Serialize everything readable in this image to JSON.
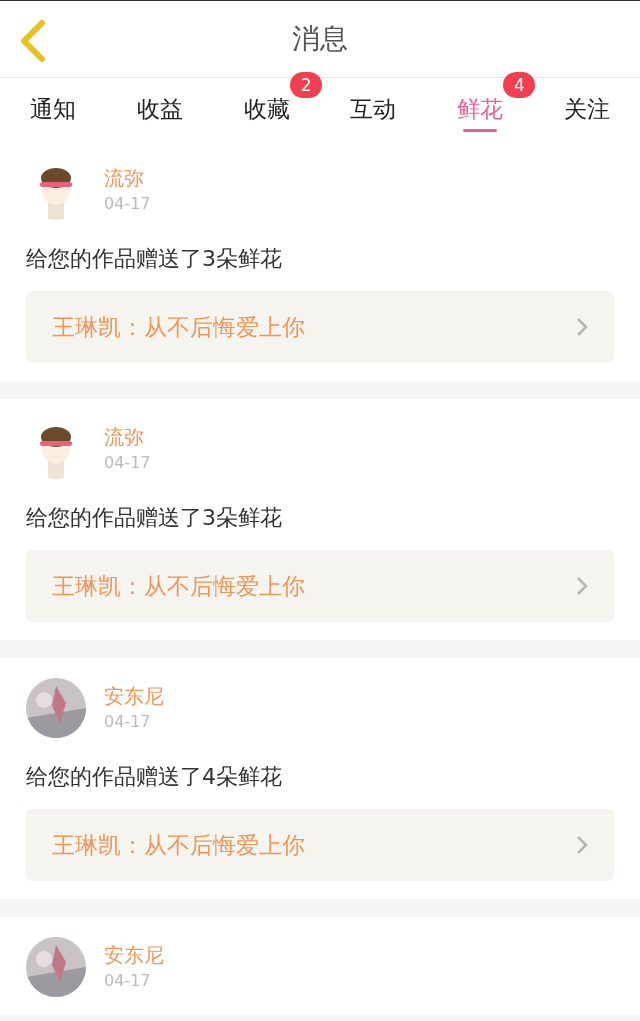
{
  "header": {
    "title": "消息"
  },
  "tabs": [
    {
      "label": "通知",
      "selected": false
    },
    {
      "label": "收益",
      "selected": false
    },
    {
      "label": "收藏",
      "selected": false,
      "badge": "2"
    },
    {
      "label": "互动",
      "selected": false
    },
    {
      "label": "鲜花",
      "selected": true,
      "badge": "4"
    },
    {
      "label": "关注",
      "selected": false
    }
  ],
  "messages": [
    {
      "name": "流弥",
      "date": "04-17",
      "text": "给您的作品赠送了3朵鲜花",
      "work": "王琳凯：从不后悔爱上你"
    },
    {
      "name": "流弥",
      "date": "04-17",
      "text": "给您的作品赠送了3朵鲜花",
      "work": "王琳凯：从不后悔爱上你"
    },
    {
      "name": "安东尼",
      "date": "04-17",
      "text": "给您的作品赠送了4朵鲜花",
      "work": "王琳凯：从不后悔爱上你"
    },
    {
      "name": "安东尼",
      "date": "04-17"
    }
  ]
}
